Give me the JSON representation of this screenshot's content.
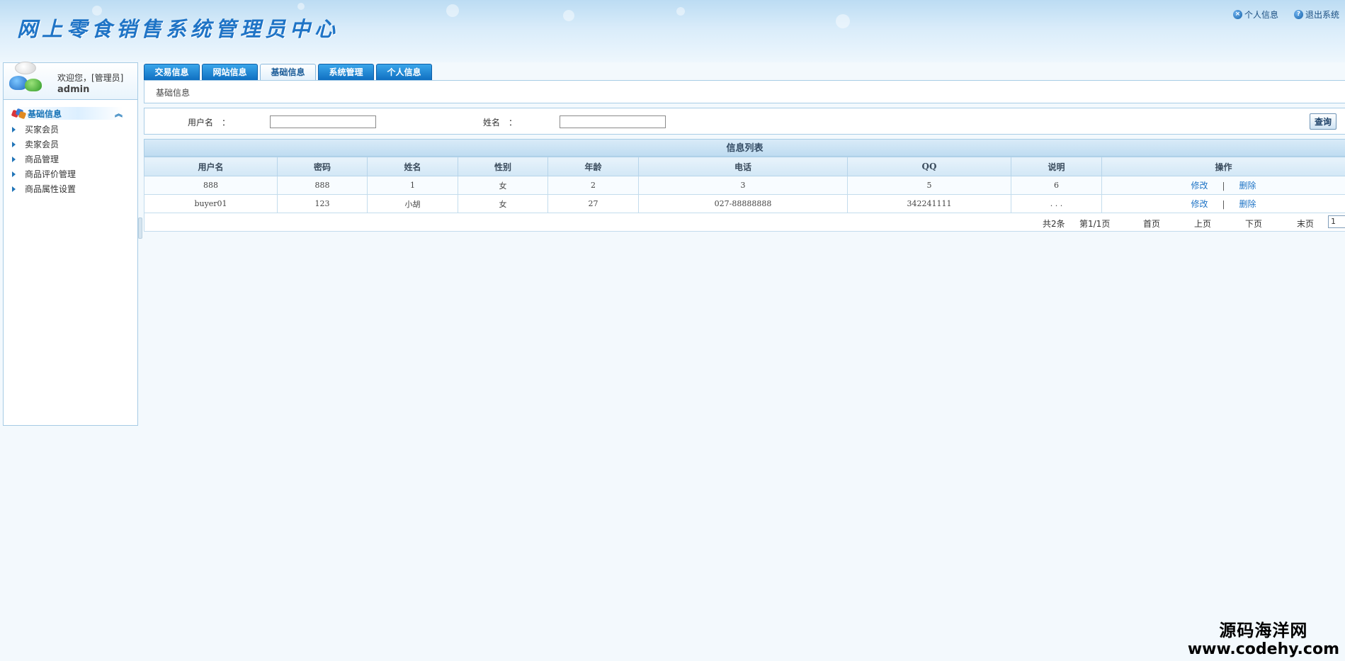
{
  "header": {
    "app_title": "网上零食销售系统管理员中心",
    "links": [
      {
        "label": "个人信息",
        "icon": "close-circle-icon"
      },
      {
        "label": "退出系统",
        "icon": "help-circle-icon"
      }
    ]
  },
  "sidebar": {
    "welcome": "欢迎您，[管理员]",
    "username": "admin",
    "group_label": "基础信息",
    "items": [
      {
        "label": "买家会员"
      },
      {
        "label": "卖家会员"
      },
      {
        "label": "商品管理"
      },
      {
        "label": "商品评价管理"
      },
      {
        "label": "商品属性设置"
      }
    ]
  },
  "tabs": [
    {
      "label": "交易信息"
    },
    {
      "label": "网站信息"
    },
    {
      "label": "基础信息",
      "active": true
    },
    {
      "label": "系统管理"
    },
    {
      "label": "个人信息"
    }
  ],
  "breadcrumb": "基础信息",
  "search": {
    "username_label": "用户名　：",
    "username_value": "",
    "name_label": "姓名　：",
    "name_value": "",
    "query_label": "查询"
  },
  "table": {
    "title": "信息列表",
    "columns": [
      "用户名",
      "密码",
      "姓名",
      "性别",
      "年龄",
      "电话",
      "QQ",
      "说明",
      "操作"
    ],
    "rows": [
      {
        "username": "888",
        "password": "888",
        "name": "1",
        "gender": "女",
        "age": "2",
        "phone": "3",
        "qq": "5",
        "note": "6"
      },
      {
        "username": "buyer01",
        "password": "123",
        "name": "小胡",
        "gender": "女",
        "age": "27",
        "phone": "027-88888888",
        "qq": "342241111",
        "note": ". . ."
      }
    ],
    "edit_label": "修改",
    "sep": "|",
    "delete_label": "删除"
  },
  "pager": {
    "total": "共2条",
    "page_info": "第1/1页",
    "first": "首页",
    "prev": "上页",
    "next": "下页",
    "last": "末页",
    "current_page": "1"
  },
  "watermark": {
    "cn": "源码海洋网",
    "url": "www.codehy.com"
  },
  "colors": {
    "accent": "#1f74c6",
    "tab_bg": "#0f6fc1",
    "border": "#a9cde6"
  }
}
